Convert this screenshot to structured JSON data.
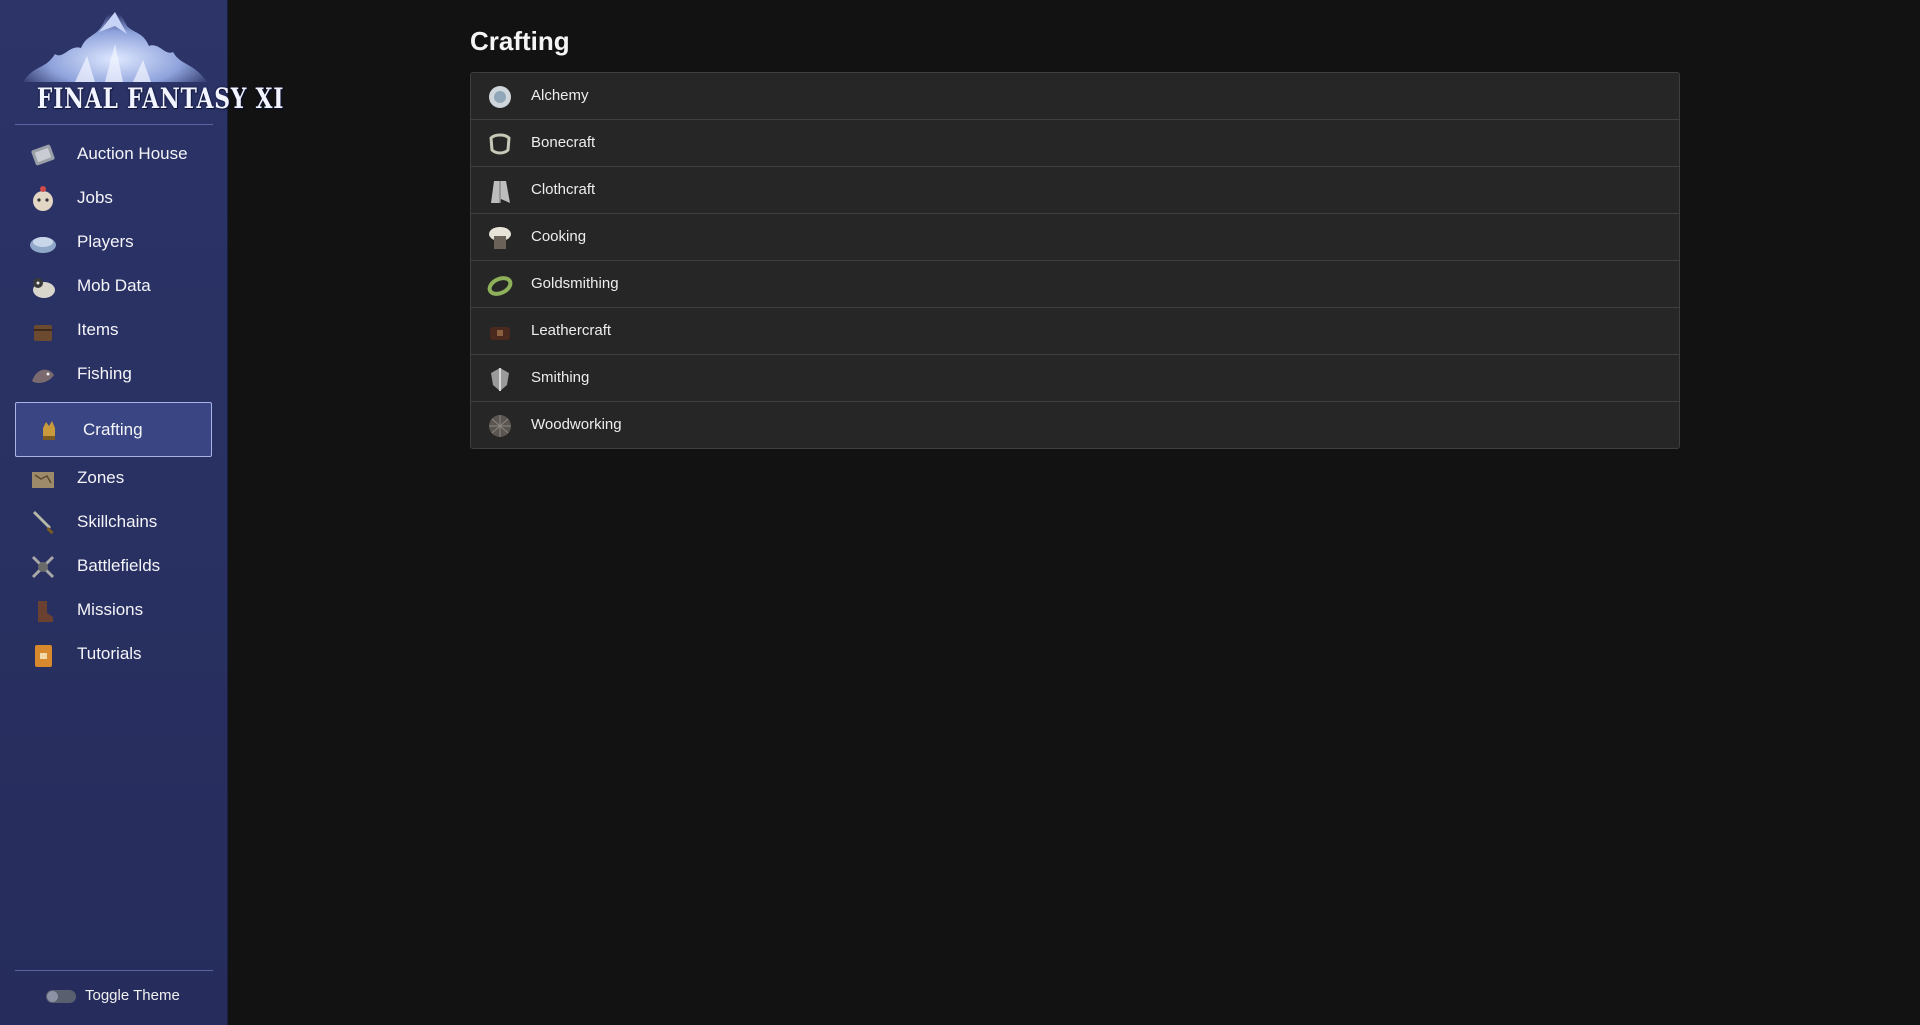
{
  "sidebar": {
    "logo_text": "FINAL FANTASY XI",
    "items": [
      {
        "label": "Auction House",
        "icon": "scroll-icon"
      },
      {
        "label": "Jobs",
        "icon": "moogle-icon"
      },
      {
        "label": "Players",
        "icon": "helmet-icon"
      },
      {
        "label": "Mob Data",
        "icon": "creature-icon"
      },
      {
        "label": "Items",
        "icon": "chest-icon"
      },
      {
        "label": "Fishing",
        "icon": "fish-icon"
      },
      {
        "label": "Crafting",
        "icon": "gauntlet-icon",
        "active": true
      },
      {
        "label": "Zones",
        "icon": "map-icon"
      },
      {
        "label": "Skillchains",
        "icon": "sword-icon"
      },
      {
        "label": "Battlefields",
        "icon": "crossed-swords-icon"
      },
      {
        "label": "Missions",
        "icon": "boot-icon"
      },
      {
        "label": "Tutorials",
        "icon": "book-icon"
      }
    ],
    "toggle_label": "Toggle Theme"
  },
  "main": {
    "title": "Crafting",
    "crafts": [
      {
        "label": "Alchemy",
        "icon": "alchemy-icon"
      },
      {
        "label": "Bonecraft",
        "icon": "bonecraft-icon"
      },
      {
        "label": "Clothcraft",
        "icon": "clothcraft-icon"
      },
      {
        "label": "Cooking",
        "icon": "cooking-icon"
      },
      {
        "label": "Goldsmithing",
        "icon": "goldsmithing-icon"
      },
      {
        "label": "Leathercraft",
        "icon": "leathercraft-icon"
      },
      {
        "label": "Smithing",
        "icon": "smithing-icon"
      },
      {
        "label": "Woodworking",
        "icon": "woodworking-icon"
      }
    ]
  },
  "colors": {
    "sidebar_bg": "#2a3264",
    "active_item_bg": "#3a4683",
    "page_bg": "#121212",
    "row_bg": "#262626"
  }
}
